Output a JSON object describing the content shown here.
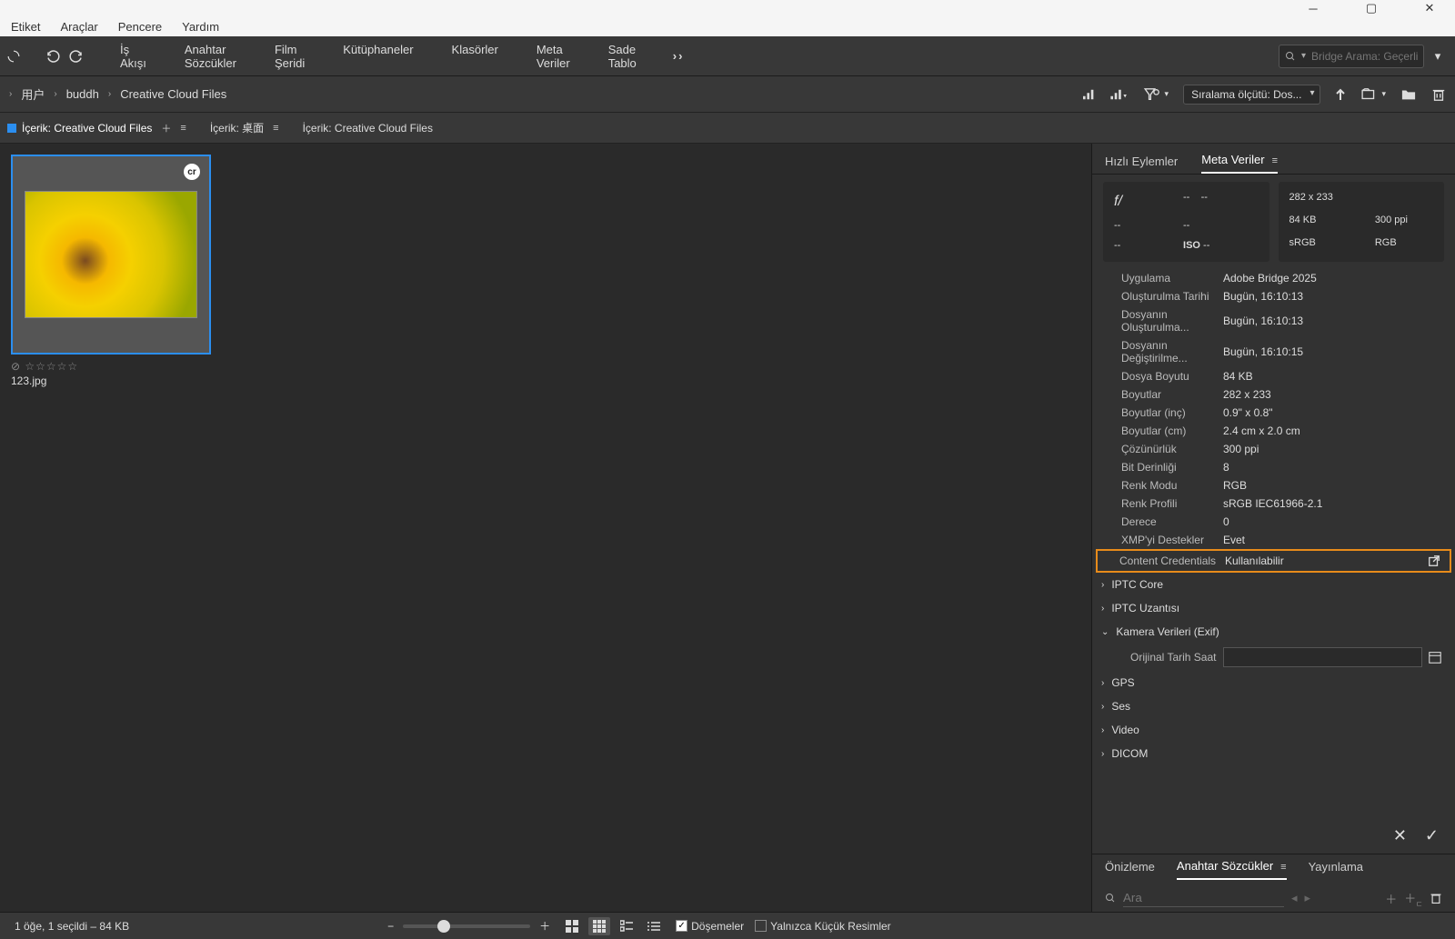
{
  "menubar": {
    "items": [
      "Etiket",
      "Araçlar",
      "Pencere",
      "Yardım"
    ]
  },
  "toolbar": {
    "tabs": [
      "İş Akışı",
      "Anahtar Sözcükler",
      "Film Şeridi",
      "Kütüphaneler",
      "Klasörler",
      "Meta Veriler",
      "Sade Tablo"
    ],
    "search_placeholder": "Bridge Arama: Geçerli"
  },
  "breadcrumb": {
    "items": [
      "用户",
      "buddh",
      "Creative Cloud Files"
    ],
    "sort_label": "Sıralama ölçütü: Dos..."
  },
  "content_tabs": {
    "t0": "İçerik: Creative Cloud Files",
    "t1": "İçerik: 桌面",
    "t2": "İçerik: Creative Cloud Files"
  },
  "thumb": {
    "cr": "cr",
    "filename": "123.jpg",
    "stars": "⊘ ☆☆☆☆☆"
  },
  "side": {
    "tabs": {
      "quick": "Hızlı Eylemler",
      "meta": "Meta Veriler"
    },
    "head": {
      "fl": "f/",
      "iso": "ISO",
      "dash": "--",
      "dim": "282 x 233",
      "size": "84 KB",
      "ppi": "300 ppi",
      "srgb": "sRGB",
      "rgb": "RGB"
    },
    "rows": [
      {
        "k": "Uygulama",
        "v": "Adobe Bridge 2025"
      },
      {
        "k": "Oluşturulma Tarihi",
        "v": "Bugün, 16:10:13"
      },
      {
        "k": "Dosyanın Oluşturulma...",
        "v": "Bugün, 16:10:13"
      },
      {
        "k": "Dosyanın Değiştirilme...",
        "v": "Bugün, 16:10:15"
      },
      {
        "k": "Dosya Boyutu",
        "v": "84 KB"
      },
      {
        "k": "Boyutlar",
        "v": "282 x 233"
      },
      {
        "k": "Boyutlar (inç)",
        "v": "0.9\" x 0.8\""
      },
      {
        "k": "Boyutlar (cm)",
        "v": "2.4 cm x 2.0 cm"
      },
      {
        "k": "Çözünürlük",
        "v": "300 ppi"
      },
      {
        "k": "Bit Derinliği",
        "v": "8"
      },
      {
        "k": "Renk Modu",
        "v": "RGB"
      },
      {
        "k": "Renk Profili",
        "v": "sRGB IEC61966-2.1"
      },
      {
        "k": "Derece",
        "v": "0"
      },
      {
        "k": "XMP'yi Destekler",
        "v": "Evet"
      }
    ],
    "highlight": {
      "k": "Content Credentials",
      "v": "Kullanılabilir"
    },
    "sections": {
      "iptc_core": "IPTC Core",
      "iptc_ext": "IPTC Uzantısı",
      "camera": "Kamera Verileri (Exif)",
      "orig_date": "Orijinal Tarih Saat",
      "gps": "GPS",
      "ses": "Ses",
      "video": "Video",
      "dicom": "DICOM"
    },
    "bottom_tabs": {
      "preview": "Önizleme",
      "keywords": "Anahtar Sözcükler",
      "publish": "Yayınlama"
    },
    "search_ph": "Ara"
  },
  "status": {
    "left": "1 öğe, 1 seçildi – 84 KB",
    "tiles": "Döşemeler",
    "thumbs_only": "Yalnızca Küçük Resimler"
  }
}
